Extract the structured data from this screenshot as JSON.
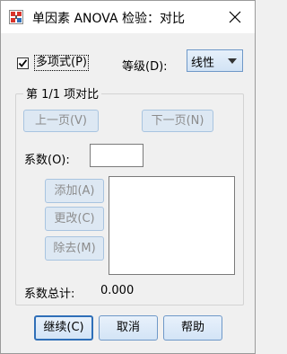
{
  "window": {
    "title": "单因素 ANOVA 检验：对比",
    "icon": "spss-dialog-icon",
    "close_icon": "close-icon"
  },
  "polynomial": {
    "label": "多项式(P)",
    "checked": true
  },
  "degree": {
    "label": "等级(D):",
    "value": "线性"
  },
  "contrast_group": {
    "legend": "第 1/1 项对比",
    "prev_label": "上一页(V)",
    "next_label": "下一页(N)",
    "coefficients_label": "系数(O):",
    "coefficients_value": "",
    "add_label": "添加(A)",
    "change_label": "更改(C)",
    "remove_label": "除去(M)",
    "total_label": "系数总计:",
    "total_value": "0.000"
  },
  "buttons": {
    "continue_label": "继续(C)",
    "cancel_label": "取消",
    "help_label": "帮助"
  },
  "colors": {
    "accent": "#2f6fb8",
    "button_bg": "#d3e4f6",
    "disabled_text": "#8c8c8c"
  }
}
